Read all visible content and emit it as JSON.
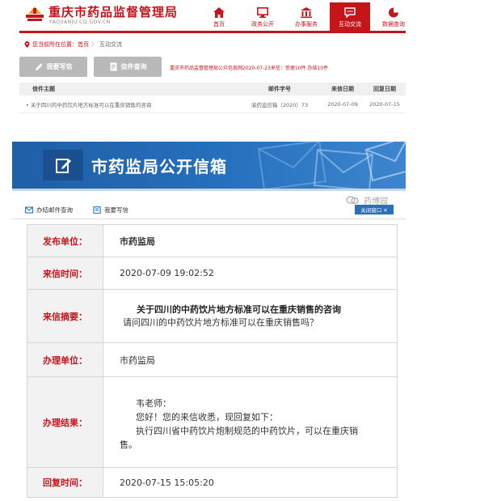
{
  "header": {
    "title": "重庆市药品监督管理局",
    "domain": "YAOJIANJU.CQ.GOV.CN",
    "brand_color": "#c5141a",
    "nav": [
      {
        "label": "首页",
        "icon": "home-icon"
      },
      {
        "label": "政务公开",
        "icon": "monitor-icon"
      },
      {
        "label": "办事服务",
        "icon": "building-icon"
      },
      {
        "label": "互动交流",
        "icon": "chat-icon",
        "active": true
      },
      {
        "label": "数据查询",
        "icon": "pie-chart-icon"
      }
    ]
  },
  "breadcrumb": {
    "prefix": "您当前所在位置：",
    "home": "首页",
    "separator": "〉",
    "current": "互动交流"
  },
  "actions": {
    "write_label": "我要写信",
    "query_label": "信件查询"
  },
  "notice": "重庆市药品监督管理局公众信息网2020-07-23来信：受理10件 办结10件",
  "letters_table": {
    "headers": [
      "信件主题",
      "邮件字号",
      "来信日期",
      "回复日期"
    ],
    "rows": [
      {
        "subject": "关于四川的中药饮片地方标准可以在重庆销售的咨询",
        "number": "渝药监信箱〔2020〕73",
        "sent": "2020-07-09",
        "replied": "2020-07-15"
      }
    ]
  },
  "mailbox": {
    "title": "市药监局公开信箱",
    "tool_inbox": "办结邮件查询",
    "tool_write": "我要写信",
    "accent_color": "#2670bd"
  },
  "watermark": {
    "text": "药博园",
    "chip": "关闭窗口 ✕"
  },
  "detail": {
    "unit_label": "发布单位：",
    "unit_value": "市药监局",
    "time_label": "来信时间：",
    "time_value": "2020-07-09 19:02:52",
    "abstract_label": "来信摘要：",
    "abstract_title": "关于四川的中药饮片地方标准可以在重庆销售的咨询",
    "abstract_body": "请问四川的中药饮片地方标准可以在重庆销售吗？",
    "office_label": "办理单位：",
    "office_value": "市药监局",
    "result_label": "办理结果：",
    "result_lines": [
      "韦老师：",
      "您好！您的来信收悉，现回复如下：",
      "执行四川省中药饮片炮制规范的中药饮片，可以在重庆销",
      "售。"
    ],
    "reply_label": "回复时间：",
    "reply_value": "2020-07-15 15:05:20"
  }
}
